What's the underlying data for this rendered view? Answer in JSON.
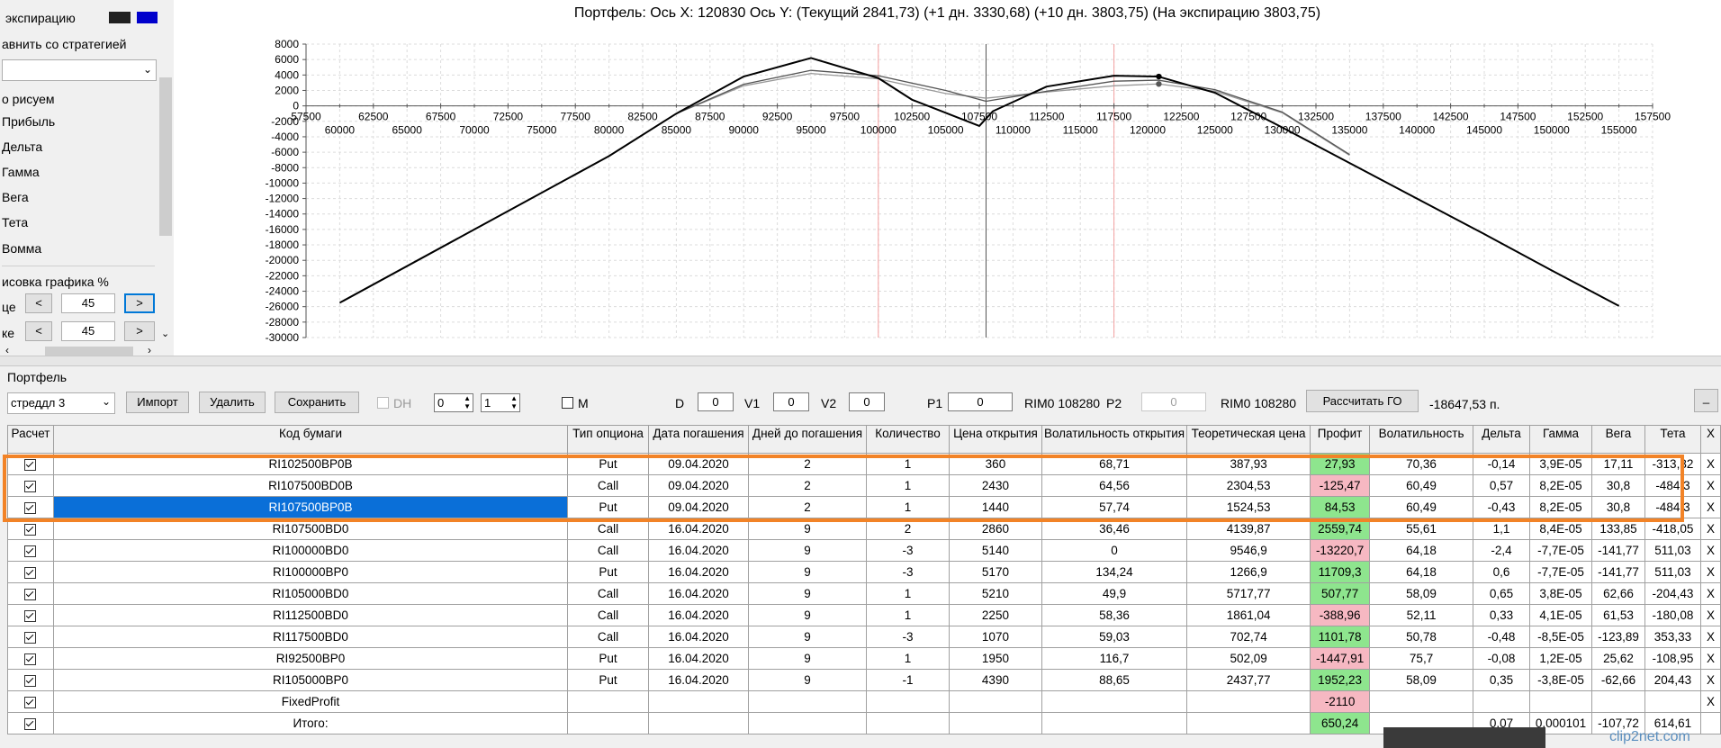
{
  "left_panel": {
    "expiration_label": "экспирацию",
    "expiration_colors": [
      "#202020",
      "#0000cc"
    ],
    "compare_label": "авнить со стратегией",
    "compare_value": "",
    "draw_label": "о рисуем",
    "options": [
      "Прибыль",
      "Дельта",
      "Гамма",
      "Вега",
      "Тета",
      "Вомма"
    ],
    "scale_label": "исовка графика %",
    "row1_label": "це",
    "row1_value": "45",
    "row2_label": "ке",
    "row2_value": "45",
    "prev": "<",
    "next": ">"
  },
  "chart": {
    "title": "Портфель: Ось X: 120830 Ось Y:  (Текущий 2841,73)  (+1 дн. 3330,68)  (+10 дн. 3803,75)  (На экспирацию 3803,75)"
  },
  "chart_data": {
    "type": "line",
    "xlim": [
      57500,
      157500
    ],
    "ylim": [
      -30000,
      8000
    ],
    "x_ticks_top": [
      "57500",
      "62500",
      "67500",
      "72500",
      "77500",
      "82500",
      "87500",
      "92500",
      "97500",
      "102500",
      "107500",
      "112500",
      "117500",
      "122500",
      "127500",
      "132500",
      "137500",
      "142500",
      "147500",
      "152500",
      "157500"
    ],
    "x_ticks_bottom": [
      "60000",
      "65000",
      "70000",
      "75000",
      "80000",
      "85000",
      "90000",
      "95000",
      "100000",
      "105000",
      "110000",
      "115000",
      "120000",
      "125000",
      "130000",
      "135000",
      "140000",
      "145000",
      "150000",
      "155000"
    ],
    "y_ticks": [
      "8000",
      "6000",
      "4000",
      "2000",
      "0",
      "-2000",
      "-4000",
      "-6000",
      "-8000",
      "-10000",
      "-12000",
      "-14000",
      "-16000",
      "-18000",
      "-20000",
      "-22000",
      "-24000",
      "-26000",
      "-28000",
      "-30000"
    ],
    "grid": true,
    "vertical_markers": [
      100000,
      108000,
      117500
    ],
    "series": [
      {
        "color": "#000000",
        "x": [
          60000,
          70000,
          80000,
          85000,
          90000,
          95000,
          100000,
          102500,
          105000,
          107500,
          108500,
          112500,
          117500,
          120800,
          125000,
          130000,
          135000,
          140000,
          145000,
          150000,
          155000
        ],
        "y": [
          -25500,
          -16000,
          -6500,
          -1000,
          3800,
          6200,
          3600,
          800,
          -900,
          -2600,
          -700,
          2500,
          3900,
          3800,
          1700,
          -2800,
          -7400,
          -12000,
          -16600,
          -21300,
          -25900
        ]
      },
      {
        "color": "#555555",
        "x": [
          85000,
          90000,
          95000,
          100000,
          105000,
          108000,
          112500,
          117500,
          120800,
          125000,
          130000,
          135000
        ],
        "y": [
          -1000,
          2800,
          4600,
          3900,
          2000,
          600,
          1900,
          3200,
          3330,
          2100,
          -800,
          -6300
        ]
      },
      {
        "color": "#999999",
        "x": [
          85000,
          90000,
          95000,
          100000,
          105000,
          108000,
          112500,
          117500,
          120800,
          125000,
          130000,
          135000
        ],
        "y": [
          -1000,
          2600,
          4200,
          3500,
          1600,
          1000,
          1800,
          2600,
          2840,
          1900,
          -900,
          -6400
        ]
      }
    ]
  },
  "toolbar": {
    "portfolio_label": "Портфель",
    "strategy": "стреддл 3",
    "import": "Импорт",
    "delete": "Удалить",
    "save": "Сохранить",
    "dh": "DH",
    "spin1": "0",
    "spin2": "1",
    "m": "M",
    "d_label": "D",
    "d_value": "0",
    "v1_label": "V1",
    "v1_value": "0",
    "v2_label": "V2",
    "v2_value": "0",
    "p1_label": "P1",
    "p1_value": "0",
    "rim1": "RIM0 108280",
    "p2_label": "P2",
    "p2_value": "0",
    "rim2": "RIM0 108280",
    "calc_go": "Рассчитать ГО",
    "go_value": "-18647,53 п.",
    "minimize": "_"
  },
  "table": {
    "headers": [
      "Расчет",
      "Код бумаги",
      "Тип опциона",
      "Дата погашения",
      "Дней до погашения",
      "Количество",
      "Цена открытия",
      "Волатильность открытия",
      "Теоретическая цена",
      "Профит",
      "Волатильность",
      "Дельта",
      "Гамма",
      "Вега",
      "Тета",
      "X"
    ],
    "rows": [
      {
        "code": "RI102500BP0B",
        "type": "Put",
        "date": "09.04.2020",
        "days": "2",
        "qty": "1",
        "price": "360",
        "vol_open": "68,71",
        "theo": "387,93",
        "profit": "27,93",
        "profit_sign": "pos",
        "vol": "70,36",
        "delta": "-0,14",
        "gamma": "3,9E-05",
        "vega": "17,11",
        "theta": "-313,32",
        "x": "X"
      },
      {
        "code": "RI107500BD0B",
        "type": "Call",
        "date": "09.04.2020",
        "days": "2",
        "qty": "1",
        "price": "2430",
        "vol_open": "64,56",
        "theo": "2304,53",
        "profit": "-125,47",
        "profit_sign": "neg",
        "vol": "60,49",
        "delta": "0,57",
        "gamma": "8,2E-05",
        "vega": "30,8",
        "theta": "-484,3",
        "x": "X"
      },
      {
        "code": "RI107500BP0B",
        "type": "Put",
        "date": "09.04.2020",
        "days": "2",
        "qty": "1",
        "price": "1440",
        "vol_open": "57,74",
        "theo": "1524,53",
        "profit": "84,53",
        "profit_sign": "pos",
        "vol": "60,49",
        "delta": "-0,43",
        "gamma": "8,2E-05",
        "vega": "30,8",
        "theta": "-484,3",
        "x": "X"
      },
      {
        "code": "RI107500BD0",
        "type": "Call",
        "date": "16.04.2020",
        "days": "9",
        "qty": "2",
        "price": "2860",
        "vol_open": "36,46",
        "theo": "4139,87",
        "profit": "2559,74",
        "profit_sign": "pos",
        "vol": "55,61",
        "delta": "1,1",
        "gamma": "8,4E-05",
        "vega": "133,85",
        "theta": "-418,05",
        "x": "X"
      },
      {
        "code": "RI100000BD0",
        "type": "Call",
        "date": "16.04.2020",
        "days": "9",
        "qty": "-3",
        "price": "5140",
        "vol_open": "0",
        "theo": "9546,9",
        "profit": "-13220,7",
        "profit_sign": "neg",
        "vol": "64,18",
        "delta": "-2,4",
        "gamma": "-7,7E-05",
        "vega": "-141,77",
        "theta": "511,03",
        "x": "X"
      },
      {
        "code": "RI100000BP0",
        "type": "Put",
        "date": "16.04.2020",
        "days": "9",
        "qty": "-3",
        "price": "5170",
        "vol_open": "134,24",
        "theo": "1266,9",
        "profit": "11709,3",
        "profit_sign": "pos",
        "vol": "64,18",
        "delta": "0,6",
        "gamma": "-7,7E-05",
        "vega": "-141,77",
        "theta": "511,03",
        "x": "X"
      },
      {
        "code": "RI105000BD0",
        "type": "Call",
        "date": "16.04.2020",
        "days": "9",
        "qty": "1",
        "price": "5210",
        "vol_open": "49,9",
        "theo": "5717,77",
        "profit": "507,77",
        "profit_sign": "pos",
        "vol": "58,09",
        "delta": "0,65",
        "gamma": "3,8E-05",
        "vega": "62,66",
        "theta": "-204,43",
        "x": "X"
      },
      {
        "code": "RI112500BD0",
        "type": "Call",
        "date": "16.04.2020",
        "days": "9",
        "qty": "1",
        "price": "2250",
        "vol_open": "58,36",
        "theo": "1861,04",
        "profit": "-388,96",
        "profit_sign": "neg",
        "vol": "52,11",
        "delta": "0,33",
        "gamma": "4,1E-05",
        "vega": "61,53",
        "theta": "-180,08",
        "x": "X"
      },
      {
        "code": "RI117500BD0",
        "type": "Call",
        "date": "16.04.2020",
        "days": "9",
        "qty": "-3",
        "price": "1070",
        "vol_open": "59,03",
        "theo": "702,74",
        "profit": "1101,78",
        "profit_sign": "pos",
        "vol": "50,78",
        "delta": "-0,48",
        "gamma": "-8,5E-05",
        "vega": "-123,89",
        "theta": "353,33",
        "x": "X"
      },
      {
        "code": "RI92500BP0",
        "type": "Put",
        "date": "16.04.2020",
        "days": "9",
        "qty": "1",
        "price": "1950",
        "vol_open": "116,7",
        "theo": "502,09",
        "profit": "-1447,91",
        "profit_sign": "neg",
        "vol": "75,7",
        "delta": "-0,08",
        "gamma": "1,2E-05",
        "vega": "25,62",
        "theta": "-108,95",
        "x": "X"
      },
      {
        "code": "RI105000BP0",
        "type": "Put",
        "date": "16.04.2020",
        "days": "9",
        "qty": "-1",
        "price": "4390",
        "vol_open": "88,65",
        "theo": "2437,77",
        "profit": "1952,23",
        "profit_sign": "pos",
        "vol": "58,09",
        "delta": "0,35",
        "gamma": "-3,8E-05",
        "vega": "-62,66",
        "theta": "204,43",
        "x": "X"
      },
      {
        "code": "FixedProfit",
        "type": "",
        "date": "",
        "days": "",
        "qty": "",
        "price": "",
        "vol_open": "",
        "theo": "",
        "profit": "-2110",
        "profit_sign": "neg",
        "vol": "",
        "delta": "",
        "gamma": "",
        "vega": "",
        "theta": "",
        "x": "X"
      },
      {
        "code": "Итого:",
        "type": "",
        "date": "",
        "days": "",
        "qty": "",
        "price": "",
        "vol_open": "",
        "theo": "",
        "profit": "650,24",
        "profit_sign": "pos",
        "vol": "",
        "delta": "0,07",
        "gamma": "0,000101",
        "vega": "-107,72",
        "theta": "614,61",
        "x": ""
      }
    ],
    "selected_row": 2
  },
  "watermark": "clip2net.com"
}
